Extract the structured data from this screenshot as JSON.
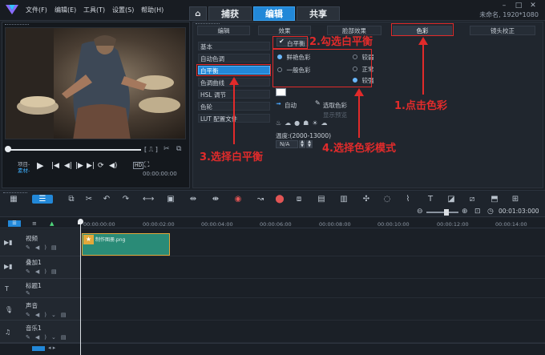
{
  "menu": [
    "文件(F)",
    "编辑(E)",
    "工具(T)",
    "设置(S)",
    "帮助(H)"
  ],
  "mode_tabs": [
    "捕获",
    "编辑",
    "共享"
  ],
  "window_title": "未命名, 1920*1080",
  "preview": {
    "project_label": "项目-",
    "clip_label": "素材-",
    "timecode": "00:00:00:00",
    "hd_badge": "HD"
  },
  "options": {
    "top_tabs": [
      "编辑",
      "效果",
      "脸部效果",
      "色彩",
      "镜头校正"
    ],
    "left_items": [
      "基本",
      "自动色调",
      "白平衡",
      "色调曲线",
      "HSL 调节",
      "色轮",
      "LUT 配置文件"
    ],
    "wb_checkbox_label": "白平衡",
    "mode_left": [
      "鲜艳色彩",
      "一般色彩"
    ],
    "mode_right": [
      "较弱",
      "正常",
      "较强"
    ],
    "auto_label": "自动",
    "pick_color_label": "选取色彩",
    "show_preview_label": "显示预览",
    "temp_label": "温度:(2000-13000)",
    "temp_value": "N/A"
  },
  "annotations": {
    "step1": "1.点击色彩",
    "step2": "2.勾选白平衡",
    "step3": "3.选择白平衡",
    "step4": "4.选择色彩模式"
  },
  "timeline": {
    "timecode": "00:01:03:000",
    "ruler": [
      "00:00:00:00",
      "00:00:02:00",
      "00:00:04:00",
      "00:00:06:00",
      "00:00:08:00",
      "00:00:10:00",
      "00:00:12:00",
      "00:00:14:00"
    ],
    "tracks": [
      "视频",
      "叠加1",
      "标题1",
      "声音",
      "音乐1"
    ],
    "clip_name": "制作图册.png"
  },
  "colors": {
    "accent": "#2288d8",
    "annotation": "#e12a2a",
    "clip": "#2a8b77"
  }
}
